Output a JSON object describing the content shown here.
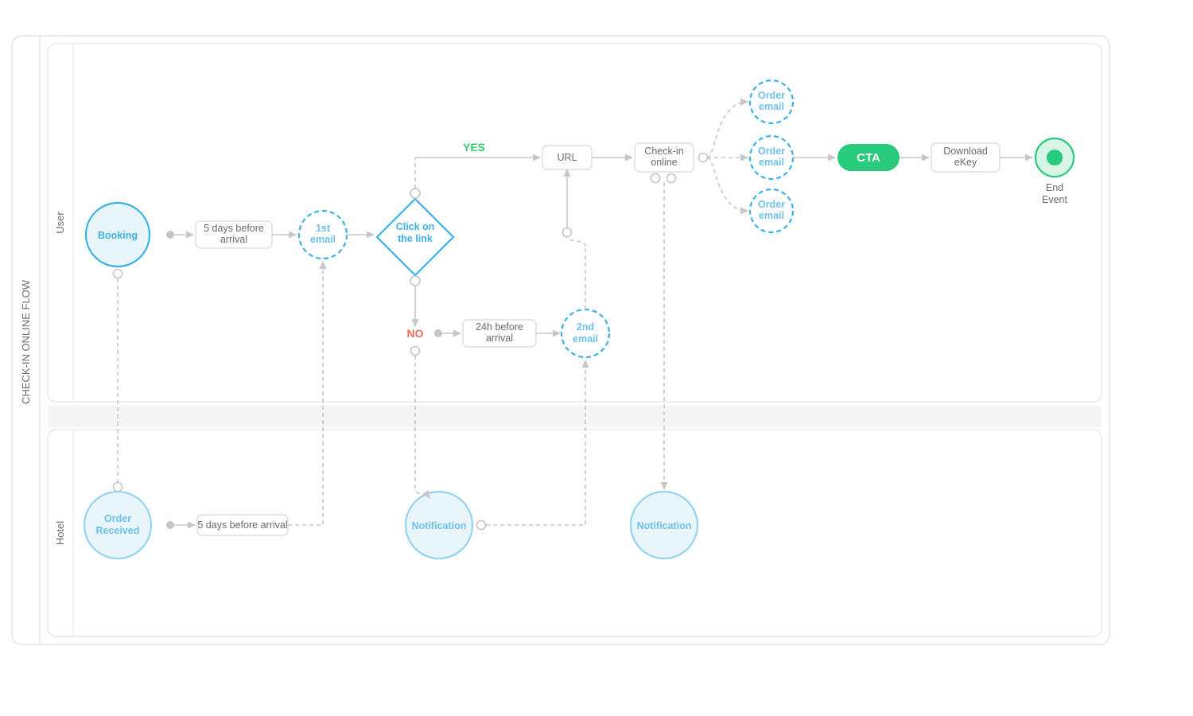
{
  "diagram": {
    "title": "CHECK-IN ONLINE FLOW",
    "lanes": {
      "user": "User",
      "hotel": "Hotel"
    },
    "nodes": {
      "booking": "Booking",
      "fiveDaysBefore": "5 days before arrival",
      "firstEmail": "1st email",
      "clickLink": "Click on the link",
      "yes": "YES",
      "no": "NO",
      "url": "URL",
      "twentyFourH": "24h before arrival",
      "secondEmail": "2nd email",
      "checkinOnline": "Check-in online",
      "orderEmail1": "Order email",
      "orderEmail2": "Order email",
      "orderEmail3": "Order email",
      "cta": "CTA",
      "downloadEKey": "Download eKey",
      "endEvent": "End Event",
      "orderReceived": "Order Received",
      "fiveDaysBefore2": "5 days before arrival",
      "notification1": "Notification",
      "notification2": "Notification"
    }
  }
}
